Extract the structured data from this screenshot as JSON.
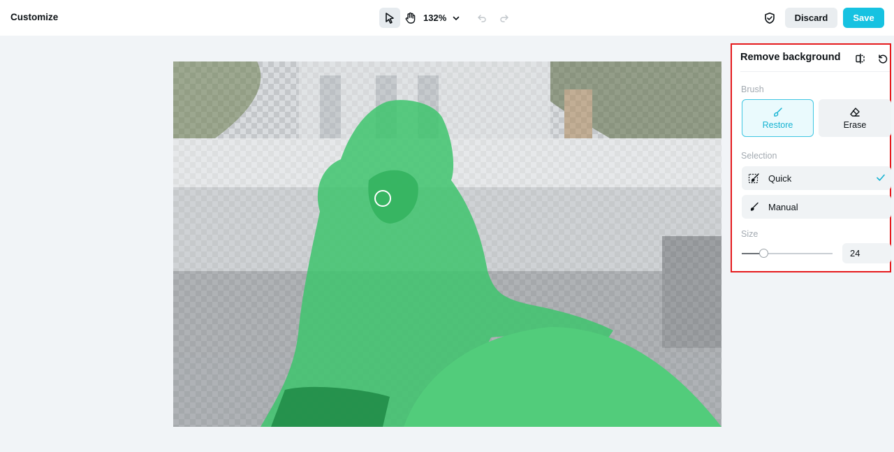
{
  "app": {
    "title": "Customize"
  },
  "toolbar": {
    "select_tool": "cursor-pointer-icon",
    "hand_tool": "hand-icon",
    "zoom_level": "132%",
    "undo": "undo-icon",
    "redo": "redo-icon",
    "shield": "shield-check-icon",
    "discard_label": "Discard",
    "save_label": "Save"
  },
  "panel": {
    "title": "Remove background",
    "brush": {
      "label": "Brush",
      "restore_label": "Restore",
      "erase_label": "Erase",
      "selected": "Restore"
    },
    "selection": {
      "label": "Selection",
      "options": [
        {
          "label": "Quick",
          "selected": true
        },
        {
          "label": "Manual",
          "selected": false
        }
      ]
    },
    "size": {
      "label": "Size",
      "value": "24",
      "slider_fraction": 0.24
    }
  },
  "colors": {
    "accent": "#16c2e1",
    "mask": "#3ec46d",
    "highlight_border": "#e5191c"
  }
}
